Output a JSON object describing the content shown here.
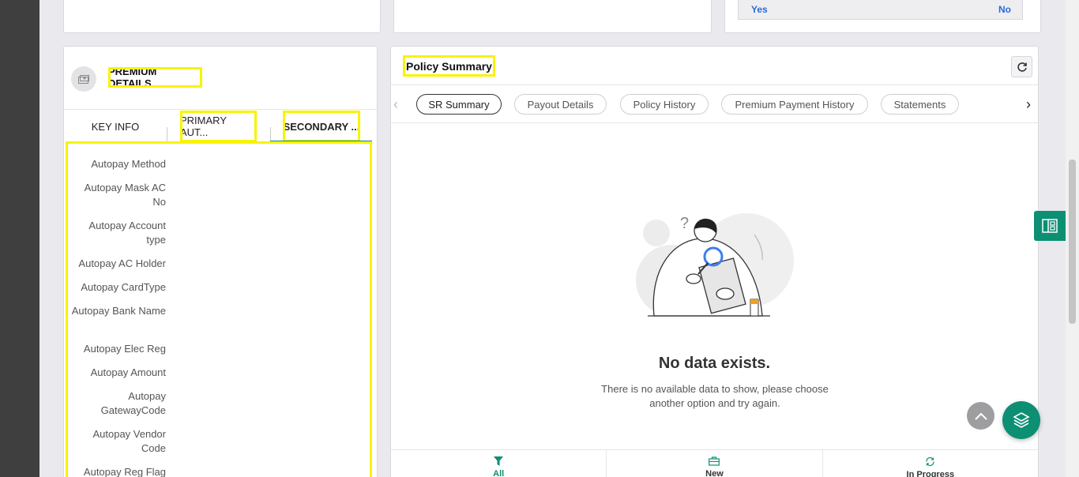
{
  "top_row": {
    "yes_label": "Yes",
    "no_label": "No"
  },
  "premium": {
    "title": "PREMIUM DETAILS",
    "tabs": [
      {
        "label": "KEY INFO",
        "active": false
      },
      {
        "label": "PRIMARY AUT...",
        "active": false
      },
      {
        "label": "SECONDARY ...",
        "active": true
      }
    ],
    "fields": [
      {
        "label": "Autopay Method"
      },
      {
        "label": "Autopay Mask AC No"
      },
      {
        "label": "Autopay Account type"
      },
      {
        "label": "Autopay AC Holder"
      },
      {
        "label": "Autopay CardType"
      },
      {
        "label": "Autopay Bank Name"
      },
      {
        "label": "Autopay Elec Reg"
      },
      {
        "label": "Autopay Amount"
      },
      {
        "label": "Autopay GatewayCode"
      },
      {
        "label": "Autopay Vendor Code"
      },
      {
        "label": "Autopay Reg Flag"
      }
    ]
  },
  "policy": {
    "title": "Policy Summary",
    "pills": [
      {
        "label": "SR Summary",
        "active": true
      },
      {
        "label": "Payout Details",
        "active": false
      },
      {
        "label": "Policy History",
        "active": false
      },
      {
        "label": "Premium Payment History",
        "active": false
      },
      {
        "label": "Statements",
        "active": false
      }
    ],
    "empty_title": "No data exists.",
    "empty_desc": "There is no available data to show, please choose another option and try again.",
    "bottom_tabs": [
      {
        "label": "All",
        "icon": "filter-icon",
        "active": true
      },
      {
        "label": "New",
        "icon": "briefcase-icon",
        "active": false
      },
      {
        "label": "In Progress",
        "icon": "sync-icon",
        "active": false
      }
    ]
  },
  "colors": {
    "accent": "#0d8f73",
    "highlight": "#f8f400",
    "rail": "#3f3f3f",
    "link": "#2a6bd6"
  }
}
